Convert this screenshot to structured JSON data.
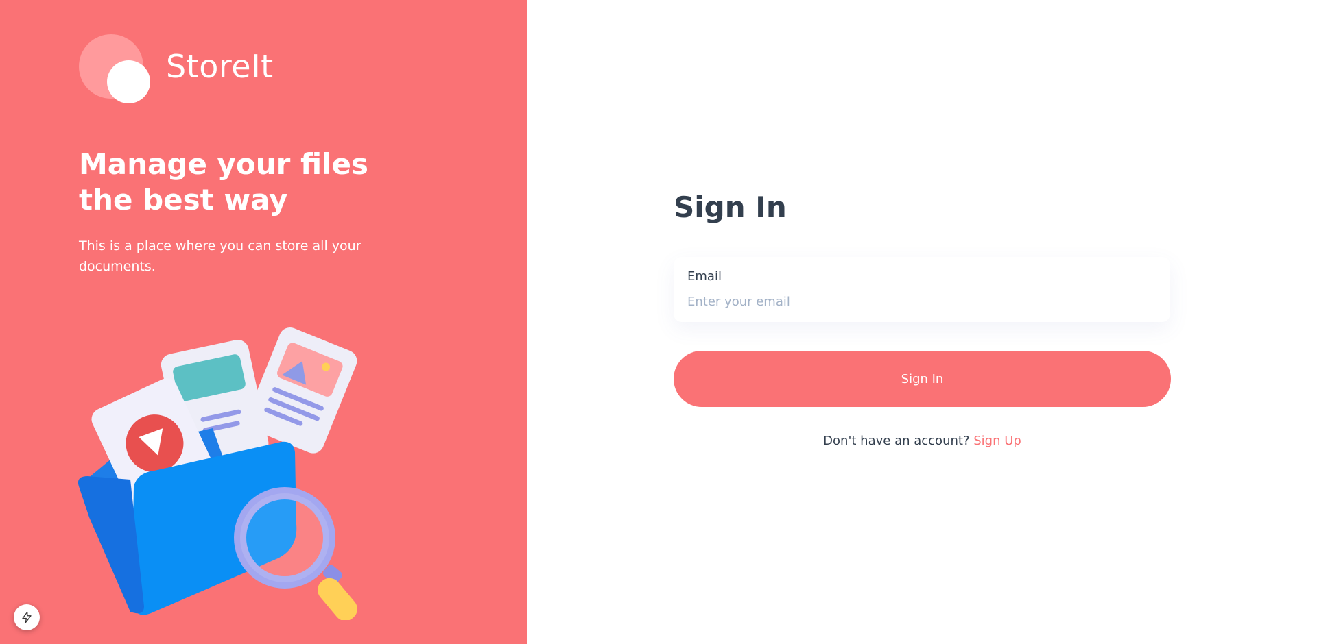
{
  "brand": {
    "name": "StoreIt"
  },
  "hero": {
    "headline": "Manage your files the best way",
    "subtext": "This is a place where you can store all your documents."
  },
  "illustration": {
    "icon": "folder-files-magnifier-illustration"
  },
  "signin": {
    "title": "Sign In",
    "email_label": "Email",
    "email_placeholder": "Enter your email",
    "email_value": "",
    "button_label": "Sign In",
    "footer_text": "Don't have an account?",
    "signup_link": "Sign Up"
  },
  "dev_badge": {
    "icon": "lightning-icon"
  },
  "colors": {
    "brand": "#fa7275",
    "brand_light": "#ff9a9c",
    "heading": "#333f4e",
    "placeholder": "#a3b2c7",
    "white": "#ffffff"
  }
}
